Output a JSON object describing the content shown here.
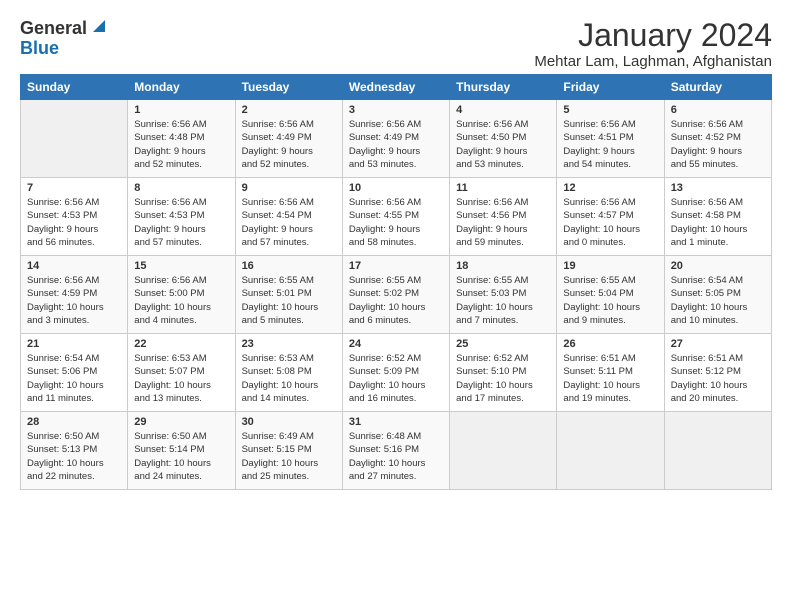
{
  "logo": {
    "general": "General",
    "blue": "Blue"
  },
  "title": "January 2024",
  "location": "Mehtar Lam, Laghman, Afghanistan",
  "days_of_week": [
    "Sunday",
    "Monday",
    "Tuesday",
    "Wednesday",
    "Thursday",
    "Friday",
    "Saturday"
  ],
  "weeks": [
    [
      {
        "day": "",
        "info": ""
      },
      {
        "day": "1",
        "info": "Sunrise: 6:56 AM\nSunset: 4:48 PM\nDaylight: 9 hours\nand 52 minutes."
      },
      {
        "day": "2",
        "info": "Sunrise: 6:56 AM\nSunset: 4:49 PM\nDaylight: 9 hours\nand 52 minutes."
      },
      {
        "day": "3",
        "info": "Sunrise: 6:56 AM\nSunset: 4:49 PM\nDaylight: 9 hours\nand 53 minutes."
      },
      {
        "day": "4",
        "info": "Sunrise: 6:56 AM\nSunset: 4:50 PM\nDaylight: 9 hours\nand 53 minutes."
      },
      {
        "day": "5",
        "info": "Sunrise: 6:56 AM\nSunset: 4:51 PM\nDaylight: 9 hours\nand 54 minutes."
      },
      {
        "day": "6",
        "info": "Sunrise: 6:56 AM\nSunset: 4:52 PM\nDaylight: 9 hours\nand 55 minutes."
      }
    ],
    [
      {
        "day": "7",
        "info": "Sunrise: 6:56 AM\nSunset: 4:53 PM\nDaylight: 9 hours\nand 56 minutes."
      },
      {
        "day": "8",
        "info": "Sunrise: 6:56 AM\nSunset: 4:53 PM\nDaylight: 9 hours\nand 57 minutes."
      },
      {
        "day": "9",
        "info": "Sunrise: 6:56 AM\nSunset: 4:54 PM\nDaylight: 9 hours\nand 57 minutes."
      },
      {
        "day": "10",
        "info": "Sunrise: 6:56 AM\nSunset: 4:55 PM\nDaylight: 9 hours\nand 58 minutes."
      },
      {
        "day": "11",
        "info": "Sunrise: 6:56 AM\nSunset: 4:56 PM\nDaylight: 9 hours\nand 59 minutes."
      },
      {
        "day": "12",
        "info": "Sunrise: 6:56 AM\nSunset: 4:57 PM\nDaylight: 10 hours\nand 0 minutes."
      },
      {
        "day": "13",
        "info": "Sunrise: 6:56 AM\nSunset: 4:58 PM\nDaylight: 10 hours\nand 1 minute."
      }
    ],
    [
      {
        "day": "14",
        "info": "Sunrise: 6:56 AM\nSunset: 4:59 PM\nDaylight: 10 hours\nand 3 minutes."
      },
      {
        "day": "15",
        "info": "Sunrise: 6:56 AM\nSunset: 5:00 PM\nDaylight: 10 hours\nand 4 minutes."
      },
      {
        "day": "16",
        "info": "Sunrise: 6:55 AM\nSunset: 5:01 PM\nDaylight: 10 hours\nand 5 minutes."
      },
      {
        "day": "17",
        "info": "Sunrise: 6:55 AM\nSunset: 5:02 PM\nDaylight: 10 hours\nand 6 minutes."
      },
      {
        "day": "18",
        "info": "Sunrise: 6:55 AM\nSunset: 5:03 PM\nDaylight: 10 hours\nand 7 minutes."
      },
      {
        "day": "19",
        "info": "Sunrise: 6:55 AM\nSunset: 5:04 PM\nDaylight: 10 hours\nand 9 minutes."
      },
      {
        "day": "20",
        "info": "Sunrise: 6:54 AM\nSunset: 5:05 PM\nDaylight: 10 hours\nand 10 minutes."
      }
    ],
    [
      {
        "day": "21",
        "info": "Sunrise: 6:54 AM\nSunset: 5:06 PM\nDaylight: 10 hours\nand 11 minutes."
      },
      {
        "day": "22",
        "info": "Sunrise: 6:53 AM\nSunset: 5:07 PM\nDaylight: 10 hours\nand 13 minutes."
      },
      {
        "day": "23",
        "info": "Sunrise: 6:53 AM\nSunset: 5:08 PM\nDaylight: 10 hours\nand 14 minutes."
      },
      {
        "day": "24",
        "info": "Sunrise: 6:52 AM\nSunset: 5:09 PM\nDaylight: 10 hours\nand 16 minutes."
      },
      {
        "day": "25",
        "info": "Sunrise: 6:52 AM\nSunset: 5:10 PM\nDaylight: 10 hours\nand 17 minutes."
      },
      {
        "day": "26",
        "info": "Sunrise: 6:51 AM\nSunset: 5:11 PM\nDaylight: 10 hours\nand 19 minutes."
      },
      {
        "day": "27",
        "info": "Sunrise: 6:51 AM\nSunset: 5:12 PM\nDaylight: 10 hours\nand 20 minutes."
      }
    ],
    [
      {
        "day": "28",
        "info": "Sunrise: 6:50 AM\nSunset: 5:13 PM\nDaylight: 10 hours\nand 22 minutes."
      },
      {
        "day": "29",
        "info": "Sunrise: 6:50 AM\nSunset: 5:14 PM\nDaylight: 10 hours\nand 24 minutes."
      },
      {
        "day": "30",
        "info": "Sunrise: 6:49 AM\nSunset: 5:15 PM\nDaylight: 10 hours\nand 25 minutes."
      },
      {
        "day": "31",
        "info": "Sunrise: 6:48 AM\nSunset: 5:16 PM\nDaylight: 10 hours\nand 27 minutes."
      },
      {
        "day": "",
        "info": ""
      },
      {
        "day": "",
        "info": ""
      },
      {
        "day": "",
        "info": ""
      }
    ]
  ]
}
